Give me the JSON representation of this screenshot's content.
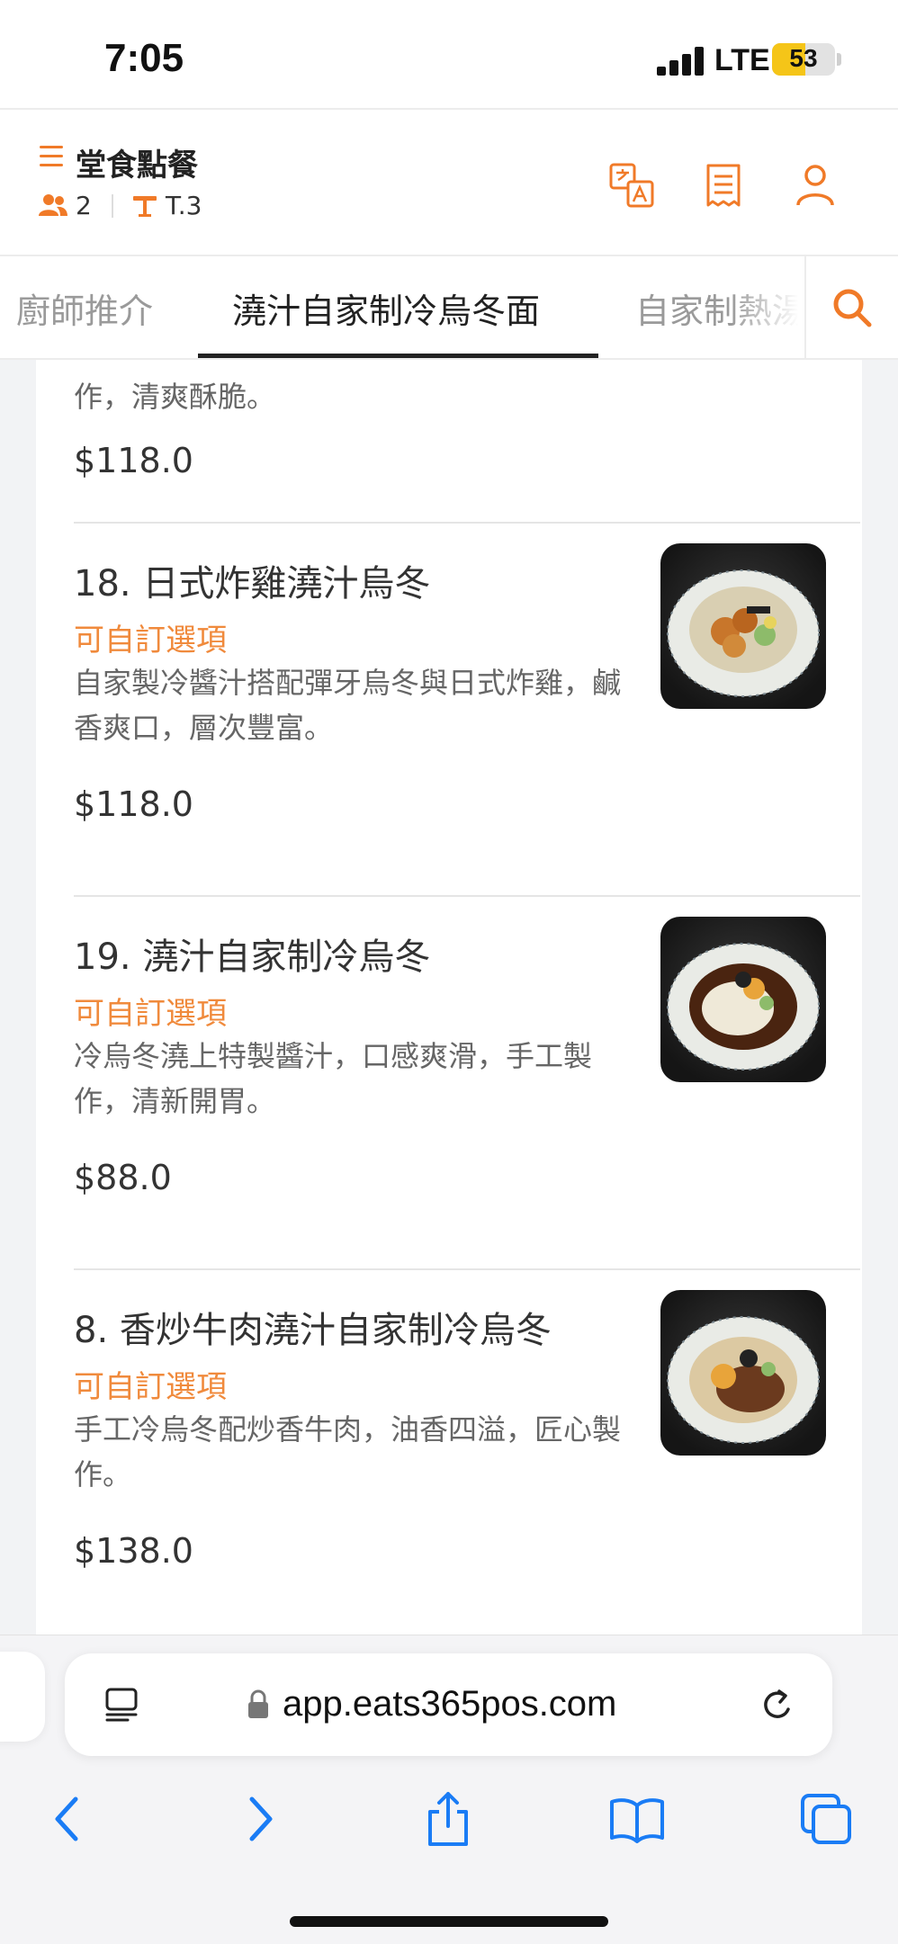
{
  "status": {
    "time": "7:05",
    "network": "LTE",
    "battery": "53",
    "battery_level": 0.53
  },
  "header": {
    "store_name": "堂食點餐",
    "guests": "2",
    "table": "T.3",
    "icons": [
      "menu-icon",
      "guests-icon",
      "table-icon",
      "translate-icon",
      "receipt-icon",
      "user-icon"
    ]
  },
  "tabs": [
    {
      "label": "廚師推介",
      "active": false
    },
    {
      "label": "澆汁自家制冷烏冬面",
      "active": true
    },
    {
      "label": "自家制熱湯",
      "active": false
    }
  ],
  "menu": {
    "partial_item": {
      "desc_tail": "作，清爽酥脆。",
      "price": "$118.0"
    },
    "items": [
      {
        "name": "18. 日式炸雞澆汁烏冬",
        "option": "可自訂選項",
        "desc": "自家製冷醬汁搭配彈牙烏冬與日式炸雞，鹹香爽口，層次豐富。",
        "price": "$118.0"
      },
      {
        "name": "19. 澆汁自家制冷烏冬",
        "option": "可自訂選項",
        "desc": "冷烏冬澆上特製醬汁，口感爽滑，手工製作，清新開胃。",
        "price": "$88.0"
      },
      {
        "name": "8. 香炒牛肉澆汁自家制冷烏冬",
        "option": "可自訂選項",
        "desc": "手工冷烏冬配炒香牛肉，油香四溢，匠心製作。",
        "price": "$138.0"
      }
    ]
  },
  "browser": {
    "url": "app.eats365pos.com",
    "icons": [
      "reader-icon",
      "lock-icon",
      "reload-icon",
      "back-icon",
      "forward-icon",
      "share-icon",
      "bookmarks-icon",
      "tabs-icon"
    ]
  },
  "colors": {
    "accent": "#f07a28",
    "option_text": "#f08a3c",
    "battery": "#f5c518"
  }
}
